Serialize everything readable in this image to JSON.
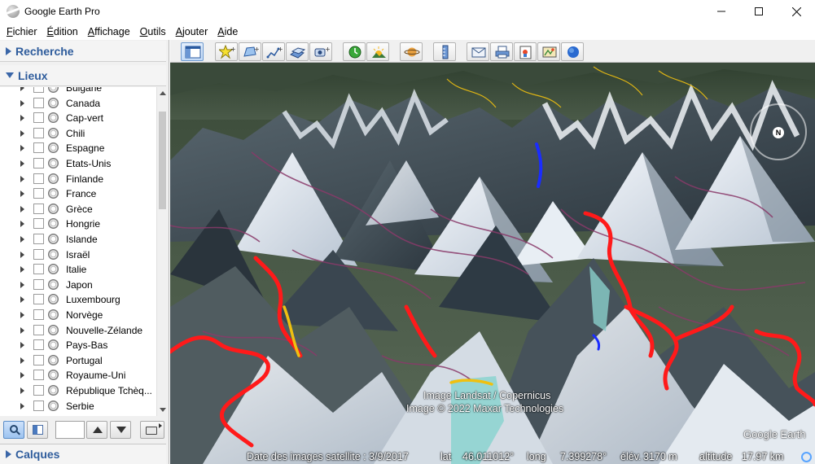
{
  "window": {
    "title": "Google Earth Pro",
    "controls": {
      "minimize": "—",
      "maximize": "",
      "close": "✕"
    }
  },
  "menu": [
    {
      "label": "Fichier"
    },
    {
      "label": "Édition"
    },
    {
      "label": "Affichage"
    },
    {
      "label": "Outils"
    },
    {
      "label": "Ajouter"
    },
    {
      "label": "Aide"
    }
  ],
  "sidebar": {
    "search_label": "Recherche",
    "places_label": "Lieux",
    "layers_label": "Calques",
    "places": [
      "Bulgarie",
      "Canada",
      "Cap-vert",
      "Chili",
      "Espagne",
      "Etats-Unis",
      "Finlande",
      "France",
      "Grèce",
      "Hongrie",
      "Islande",
      "Israël",
      "Italie",
      "Japon",
      "Luxembourg",
      "Norvège",
      "Nouvelle-Zélande",
      "Pays-Bas",
      "Portugal",
      "Royaume-Uni",
      "République Tchèq...",
      "Serbie"
    ],
    "order_input_value": ""
  },
  "toolbar": {
    "buttons": [
      "sidebar-toggle-icon",
      "placemark-icon",
      "polygon-icon",
      "path-icon",
      "image-overlay-icon",
      "record-tour-icon",
      "historical-imagery-icon",
      "sunlight-icon",
      "planets-icon",
      "ruler-icon",
      "email-icon",
      "print-icon",
      "save-image-icon",
      "view-in-maps-icon",
      "earth-icon"
    ]
  },
  "map": {
    "credits": [
      "Image Landsat / Copernicus",
      "Image © 2022 Maxar Technologies"
    ],
    "logo": "Google Earth",
    "compass_label": "N",
    "status": {
      "imagery_date": "Date des images satellite : 3/9/2017",
      "lat_label": "lat",
      "lat_value": "46.011012°",
      "lon_label": "long",
      "lon_value": "7.399278°",
      "elev_label": "élév.",
      "elev_value": "3170 m",
      "alt_label": "altitude",
      "alt_value": "17.97 km"
    }
  },
  "colors": {
    "panel_header_text": "#2e5c9c",
    "trail_red": "#ff1a1a",
    "trail_yellow": "#f0c010",
    "trail_blue": "#1a2cff"
  }
}
